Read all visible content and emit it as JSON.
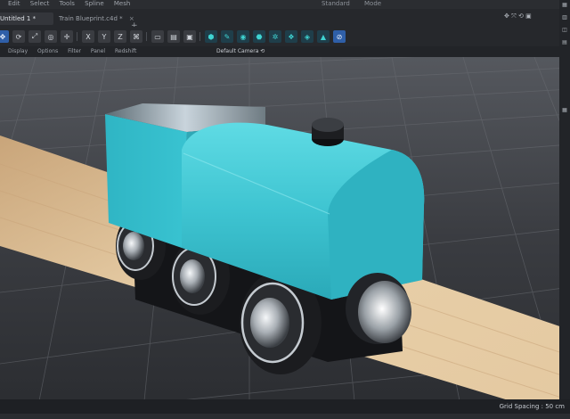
{
  "menubar": {
    "items": [
      "Edit",
      "Select",
      "Tools",
      "Spline",
      "Mesh"
    ],
    "layout_label": "Standard",
    "mode_label": "Mode"
  },
  "tabs": [
    {
      "label": "Untitled 1 *"
    },
    {
      "label": "Train Blueprint.c4d *"
    }
  ],
  "tab_close_glyph": "×",
  "new_tab_glyph": "+",
  "toolbar": {
    "axis_x": "X",
    "axis_y": "Y",
    "axis_z": "Z",
    "accent": "#2f5fa8",
    "object_color": "#3fd4d2"
  },
  "viewport_menu": {
    "items": [
      "Display",
      "Options",
      "Filter",
      "Panel",
      "Redshift"
    ],
    "camera_label": "Default Camera ⟲"
  },
  "status": {
    "grid_spacing": "Grid Spacing : 50 cm"
  },
  "colors": {
    "train_body": "#3fc3cf",
    "wood_rail": "#e2c49a",
    "floor": "#2d2f34"
  }
}
